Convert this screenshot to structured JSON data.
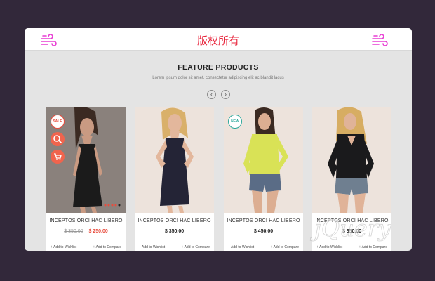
{
  "header": {
    "title": "版权所有"
  },
  "section": {
    "heading": "FEATURE PRODUCTS",
    "subheading": "Lorem ipsum dolor sit amet, consectetur adipiscing elit ac blandit lacus"
  },
  "nav": {
    "prev": "‹",
    "next": "›"
  },
  "products": [
    {
      "name": "INCEPTOS ORCI HAC LIBERO",
      "old_price": "$ 350.00",
      "price": "$ 250.00",
      "badge": "SALE",
      "wishlist": "+ Add to Wishlist",
      "compare": "+ Add to Compare"
    },
    {
      "name": "INCEPTOS ORCI HAC LIBERO",
      "price": "$ 350.00",
      "wishlist": "+ Add to Wishlist",
      "compare": "+ Add to Compare"
    },
    {
      "name": "INCEPTOS ORCI HAC LIBERO",
      "price": "$ 450.00",
      "badge": "NEW",
      "wishlist": "+ Add to Wishlist",
      "compare": "+ Add to Compare"
    },
    {
      "name": "INCEPTOS ORCI HAC LIBERO",
      "price": "$ 350.00",
      "wishlist": "+ Add to Wishlist",
      "compare": "+ Add to Compare"
    }
  ],
  "watermark": {
    "text": "jQuery"
  },
  "colors": {
    "accent": "#e84c3d",
    "title_red": "#e8243b",
    "icon_magenta": "#e83cd3",
    "new_teal": "#2aa89b",
    "page_bg": "#32283a",
    "panel_bg": "#e4e4e4"
  }
}
